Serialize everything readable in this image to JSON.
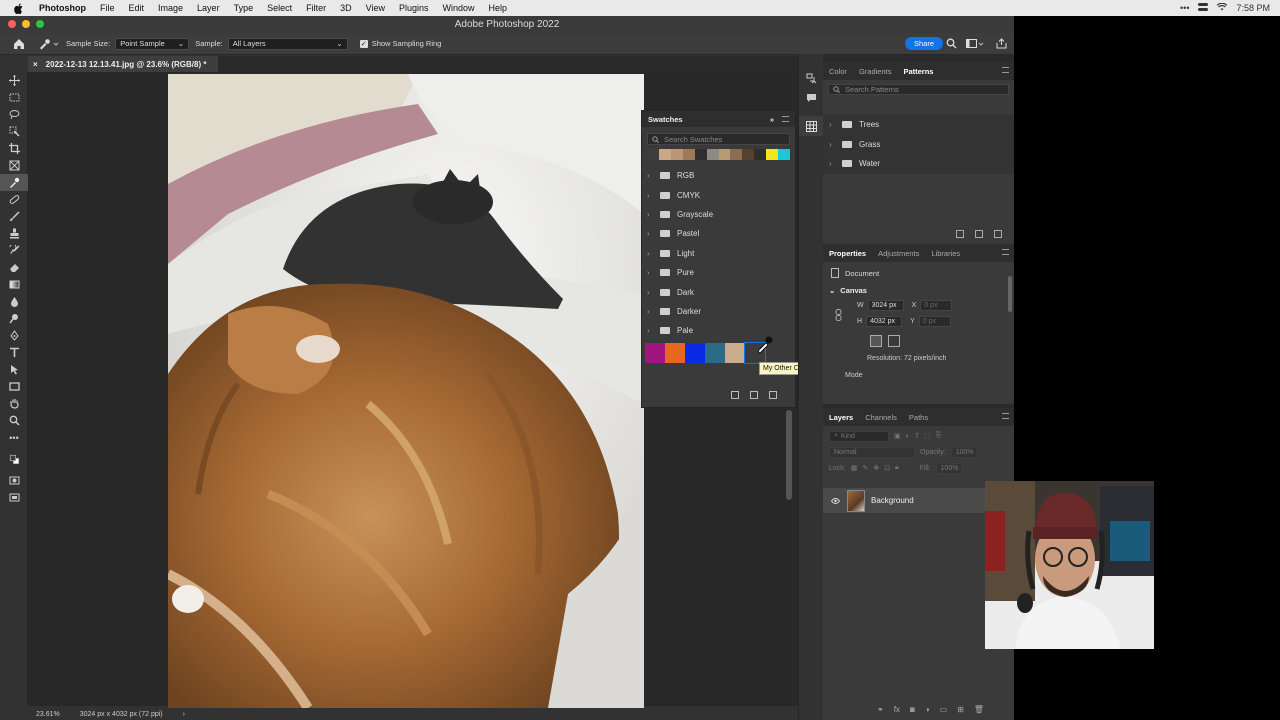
{
  "menubar": {
    "items": [
      "Photoshop",
      "File",
      "Edit",
      "Image",
      "Layer",
      "Type",
      "Select",
      "Filter",
      "3D",
      "View",
      "Plugins",
      "Window",
      "Help"
    ],
    "clock": "7:58 PM"
  },
  "window": {
    "title": "Adobe Photoshop 2022"
  },
  "options": {
    "sample_size_label": "Sample Size:",
    "sample_size_value": "Point Sample",
    "sample_label": "Sample:",
    "sample_value": "All Layers",
    "show_ring_label": "Show Sampling Ring",
    "share_label": "Share"
  },
  "document": {
    "tab_title": "2022-12-13 12.13.41.jpg @ 23.6% (RGB/8) *"
  },
  "status": {
    "zoom": "23.61%",
    "dims": "3024 px x 4032 px (72 ppi)"
  },
  "swatches": {
    "title": "Swatches",
    "search_placeholder": "Search Swatches",
    "recent_colors": [
      "#3d3d3d",
      "#c9a983",
      "#b89677",
      "#9b7a5a",
      "#2e2e2e",
      "#8d8a84",
      "#b69b73",
      "#8c6e52",
      "#54412f",
      "#2e2e2e",
      "#f6e51a",
      "#1ac8dc"
    ],
    "groups": [
      "RGB",
      "CMYK",
      "Grayscale",
      "Pastel",
      "Light",
      "Pure",
      "Dark",
      "Darker",
      "Pale"
    ],
    "custom_colors": [
      "#a0157f",
      "#e8661e",
      "#0a2ae6",
      "#2a6b86",
      "#cbad8c",
      "#3b3b3b"
    ],
    "tooltip": "My Other Cat"
  },
  "patterns_panel": {
    "tabs": [
      "Color",
      "Gradients",
      "Patterns"
    ],
    "active_tab": "Patterns",
    "search_placeholder": "Search Patterns",
    "groups": [
      "Trees",
      "Grass",
      "Water"
    ]
  },
  "properties_panel": {
    "tabs": [
      "Properties",
      "Adjustments",
      "Libraries"
    ],
    "active_tab": "Properties",
    "document_label": "Document",
    "canvas_label": "Canvas",
    "w_label": "W",
    "w_value": "3024 px",
    "h_label": "H",
    "h_value": "4032 px",
    "x_label": "X",
    "y_label": "Y",
    "x_placeholder": "0 px",
    "y_placeholder": "0 px",
    "resolution": "Resolution: 72 pixels/inch",
    "mode_label": "Mode"
  },
  "layers_panel": {
    "tabs": [
      "Layers",
      "Channels",
      "Paths"
    ],
    "active_tab": "Layers",
    "kind_label": "Kind",
    "blend_mode": "Normal",
    "opacity_label": "Opacity:",
    "opacity_value": "100%",
    "lock_label": "Lock:",
    "fill_label": "Fill:",
    "fill_value": "100%",
    "layers": [
      {
        "name": "Background",
        "visible": true
      }
    ]
  },
  "colors": {
    "accent": "#1473e6",
    "panel_bg": "#3a3a3a",
    "canvas_bg": "#282828"
  }
}
